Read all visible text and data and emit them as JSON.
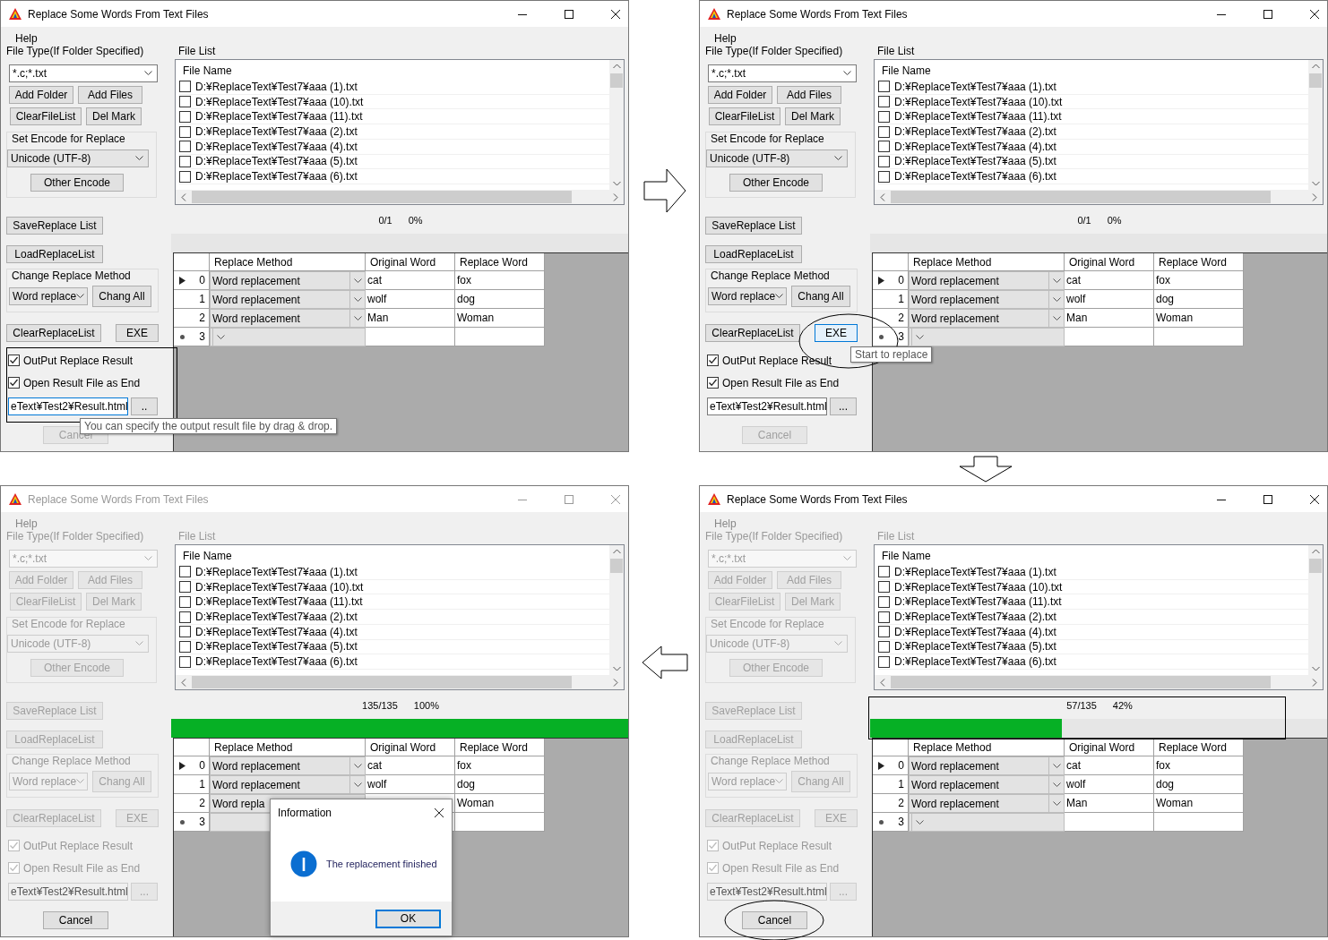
{
  "windows": [
    {
      "title": "Replace Some Words From Text Files",
      "active": true,
      "controls_enabled": true,
      "menu": [
        "Help"
      ],
      "file_type": {
        "label": "File Type(If Folder Specified)",
        "value": "*.c;*.txt"
      },
      "file_buttons": [
        "Add Folder",
        "Add Files",
        "ClearFileList",
        "Del Mark"
      ],
      "encode": {
        "label": "Set Encode for Replace",
        "value": "Unicode (UTF-8)",
        "button": "Other Encode"
      },
      "save_button": "SaveReplace List",
      "load_button": "LoadReplaceList",
      "method": {
        "label": "Change Replace Method",
        "value": "Word replace",
        "button": "Chang All"
      },
      "clear_button": "ClearReplaceList",
      "exe": {
        "label": "EXE",
        "focused": false
      },
      "options": {
        "boxed": true,
        "items": [
          {
            "label": "OutPut Replace Result",
            "checked": true
          },
          {
            "label": "Open Result File as End",
            "checked": true
          }
        ]
      },
      "output": {
        "value": "eText¥Test2¥Result.html",
        "focused": true,
        "browse": ".."
      },
      "cancel": {
        "label": "Cancel",
        "disabled": true
      },
      "file_list": {
        "label": "File List",
        "header": "File Name",
        "files": [
          {
            "name": "D:¥ReplaceText¥Test7¥aaa (1).txt",
            "checked": false
          },
          {
            "name": "D:¥ReplaceText¥Test7¥aaa (10).txt",
            "checked": false
          },
          {
            "name": "D:¥ReplaceText¥Test7¥aaa (11).txt",
            "checked": false
          },
          {
            "name": "D:¥ReplaceText¥Test7¥aaa (2).txt",
            "checked": false
          },
          {
            "name": "D:¥ReplaceText¥Test7¥aaa (4).txt",
            "checked": false
          },
          {
            "name": "D:¥ReplaceText¥Test7¥aaa (5).txt",
            "checked": false
          },
          {
            "name": "D:¥ReplaceText¥Test7¥aaa (6).txt",
            "checked": false
          }
        ]
      },
      "progress": {
        "count": "0/1",
        "percent": "0%",
        "level": 0
      },
      "grid": {
        "columns": [
          "Replace Method",
          "Original Word",
          "Replace Word"
        ],
        "rows": [
          {
            "kind": "current",
            "index": "0",
            "method": "Word replacement",
            "original": "cat",
            "replacement": "fox"
          },
          {
            "kind": "plain",
            "index": "1",
            "method": "Word replacement",
            "original": "wolf",
            "replacement": "dog"
          },
          {
            "kind": "plain",
            "index": "2",
            "method": "Word replacement",
            "original": "Man",
            "replacement": "Woman"
          },
          {
            "kind": "new",
            "index": "3"
          }
        ]
      },
      "tooltip": "You can specify the output result file by drag & drop."
    },
    {
      "title": "Replace Some Words From Text Files",
      "active": true,
      "controls_enabled": true,
      "menu": [
        "Help"
      ],
      "file_type": {
        "label": "File Type(If Folder Specified)",
        "value": "*.c;*.txt"
      },
      "file_buttons": [
        "Add Folder",
        "Add Files",
        "ClearFileList",
        "Del Mark"
      ],
      "encode": {
        "label": "Set Encode for Replace",
        "value": "Unicode (UTF-8)",
        "button": "Other Encode"
      },
      "save_button": "SaveReplace List",
      "load_button": "LoadReplaceList",
      "method": {
        "label": "Change Replace Method",
        "value": "Word replace",
        "button": "Chang All"
      },
      "clear_button": "ClearReplaceList",
      "exe": {
        "label": "EXE",
        "focused": true,
        "circled": true
      },
      "options": {
        "items": [
          {
            "label": "OutPut Replace Result",
            "checked": true
          },
          {
            "label": "Open Result File as End",
            "checked": true
          }
        ]
      },
      "output": {
        "value": "eText¥Test2¥Result.html",
        "focused": false,
        "browse": "..."
      },
      "cancel": {
        "label": "Cancel",
        "disabled": true
      },
      "file_list": {
        "label": "File List",
        "header": "File Name",
        "files": [
          {
            "name": "D:¥ReplaceText¥Test7¥aaa (1).txt",
            "checked": false
          },
          {
            "name": "D:¥ReplaceText¥Test7¥aaa (10).txt",
            "checked": false
          },
          {
            "name": "D:¥ReplaceText¥Test7¥aaa (11).txt",
            "checked": false
          },
          {
            "name": "D:¥ReplaceText¥Test7¥aaa (2).txt",
            "checked": false
          },
          {
            "name": "D:¥ReplaceText¥Test7¥aaa (4).txt",
            "checked": false
          },
          {
            "name": "D:¥ReplaceText¥Test7¥aaa (5).txt",
            "checked": false
          },
          {
            "name": "D:¥ReplaceText¥Test7¥aaa (6).txt",
            "checked": false
          }
        ]
      },
      "progress": {
        "count": "0/1",
        "percent": "0%",
        "level": 0
      },
      "grid": {
        "columns": [
          "Replace Method",
          "Original Word",
          "Replace Word"
        ],
        "rows": [
          {
            "kind": "current",
            "index": "0",
            "method": "Word replacement",
            "original": "cat",
            "replacement": "fox"
          },
          {
            "kind": "plain",
            "index": "1",
            "method": "Word replacement",
            "original": "wolf",
            "replacement": "dog"
          },
          {
            "kind": "plain",
            "index": "2",
            "method": "Word replacement",
            "original": "Man",
            "replacement": "Woman"
          },
          {
            "kind": "new",
            "index": "3"
          }
        ]
      },
      "tooltip": "Start to replace"
    },
    {
      "title": "Replace Some Words From Text Files",
      "active": false,
      "controls_enabled": false,
      "menu": [
        "Help"
      ],
      "file_type": {
        "label": "File Type(If Folder Specified)",
        "value": "*.c;*.txt"
      },
      "file_buttons": [
        "Add Folder",
        "Add Files",
        "ClearFileList",
        "Del Mark"
      ],
      "encode": {
        "label": "Set Encode for Replace",
        "value": "Unicode (UTF-8)",
        "button": "Other Encode"
      },
      "save_button": "SaveReplace List",
      "load_button": "LoadReplaceList",
      "method": {
        "label": "Change Replace Method",
        "value": "Word replace",
        "button": "Chang All"
      },
      "clear_button": "ClearReplaceList",
      "exe": {
        "label": "EXE",
        "focused": false
      },
      "options": {
        "items": [
          {
            "label": "OutPut Replace Result",
            "checked": true
          },
          {
            "label": "Open Result File as End",
            "checked": true
          }
        ]
      },
      "output": {
        "value": "eText¥Test2¥Result.html",
        "focused": false,
        "browse": "..."
      },
      "cancel": {
        "label": "Cancel",
        "disabled": false
      },
      "file_list": {
        "label": "File List",
        "header": "File Name",
        "files": [
          {
            "name": "D:¥ReplaceText¥Test7¥aaa (1).txt",
            "checked": false
          },
          {
            "name": "D:¥ReplaceText¥Test7¥aaa (10).txt",
            "checked": false
          },
          {
            "name": "D:¥ReplaceText¥Test7¥aaa (11).txt",
            "checked": false
          },
          {
            "name": "D:¥ReplaceText¥Test7¥aaa (2).txt",
            "checked": false
          },
          {
            "name": "D:¥ReplaceText¥Test7¥aaa (4).txt",
            "checked": false
          },
          {
            "name": "D:¥ReplaceText¥Test7¥aaa (5).txt",
            "checked": false
          },
          {
            "name": "D:¥ReplaceText¥Test7¥aaa (6).txt",
            "checked": false
          }
        ]
      },
      "progress": {
        "count": "135/135",
        "percent": "100%",
        "level": 1
      },
      "grid": {
        "columns": [
          "Replace Method",
          "Original Word",
          "Replace Word"
        ],
        "rows": [
          {
            "kind": "current",
            "index": "0",
            "method": "Word replacement",
            "original": "cat",
            "replacement": "fox",
            "dropdown": true
          },
          {
            "kind": "plain",
            "index": "1",
            "method": "Word replacement",
            "original": "wolf",
            "replacement": "dog",
            "dropdown": true
          },
          {
            "kind": "plain",
            "index": "2",
            "method": "Word repla",
            "replacement": "Woman",
            "dropdown": false
          },
          {
            "kind": "new",
            "index": "3",
            "dropdown": false
          }
        ]
      },
      "dialog": {
        "title": "Information",
        "message": "The replacement finished",
        "button": "OK"
      }
    },
    {
      "title": "Replace Some Words From Text Files",
      "active": true,
      "controls_enabled": false,
      "menu": [
        "Help"
      ],
      "file_type": {
        "label": "File Type(If Folder Specified)",
        "value": "*.c;*.txt"
      },
      "file_buttons": [
        "Add Folder",
        "Add Files",
        "ClearFileList",
        "Del Mark"
      ],
      "encode": {
        "label": "Set Encode for Replace",
        "value": "Unicode (UTF-8)",
        "button": "Other Encode"
      },
      "save_button": "SaveReplace List",
      "load_button": "LoadReplaceList",
      "method": {
        "label": "Change Replace Method",
        "value": "Word replace",
        "button": "Chang All"
      },
      "clear_button": "ClearReplaceList",
      "exe": {
        "label": "EXE",
        "focused": false
      },
      "options": {
        "items": [
          {
            "label": "OutPut Replace Result",
            "checked": true
          },
          {
            "label": "Open Result File as End",
            "checked": true
          }
        ]
      },
      "output": {
        "value": "eText¥Test2¥Result.html",
        "focused": false,
        "browse": "..."
      },
      "cancel": {
        "label": "Cancel",
        "disabled": false,
        "circled": true
      },
      "file_list": {
        "label": "File List",
        "header": "File Name",
        "files": [
          {
            "name": "D:¥ReplaceText¥Test7¥aaa (1).txt",
            "checked": false
          },
          {
            "name": "D:¥ReplaceText¥Test7¥aaa (10).txt",
            "checked": false
          },
          {
            "name": "D:¥ReplaceText¥Test7¥aaa (11).txt",
            "checked": false
          },
          {
            "name": "D:¥ReplaceText¥Test7¥aaa (2).txt",
            "checked": false
          },
          {
            "name": "D:¥ReplaceText¥Test7¥aaa (4).txt",
            "checked": false
          },
          {
            "name": "D:¥ReplaceText¥Test7¥aaa (5).txt",
            "checked": false
          },
          {
            "name": "D:¥ReplaceText¥Test7¥aaa (6).txt",
            "checked": false
          }
        ]
      },
      "progress": {
        "count": "57/135",
        "percent": "42%",
        "level": 0.42,
        "boxed": true
      },
      "grid": {
        "columns": [
          "Replace Method",
          "Original Word",
          "Replace Word"
        ],
        "rows": [
          {
            "kind": "current",
            "index": "0",
            "method": "Word replacement",
            "original": "cat",
            "replacement": "fox"
          },
          {
            "kind": "plain",
            "index": "1",
            "method": "Word replacement",
            "original": "wolf",
            "replacement": "dog"
          },
          {
            "kind": "plain",
            "index": "2",
            "method": "Word replacement",
            "original": "Man",
            "replacement": "Woman"
          },
          {
            "kind": "new",
            "index": "3"
          }
        ]
      }
    }
  ]
}
